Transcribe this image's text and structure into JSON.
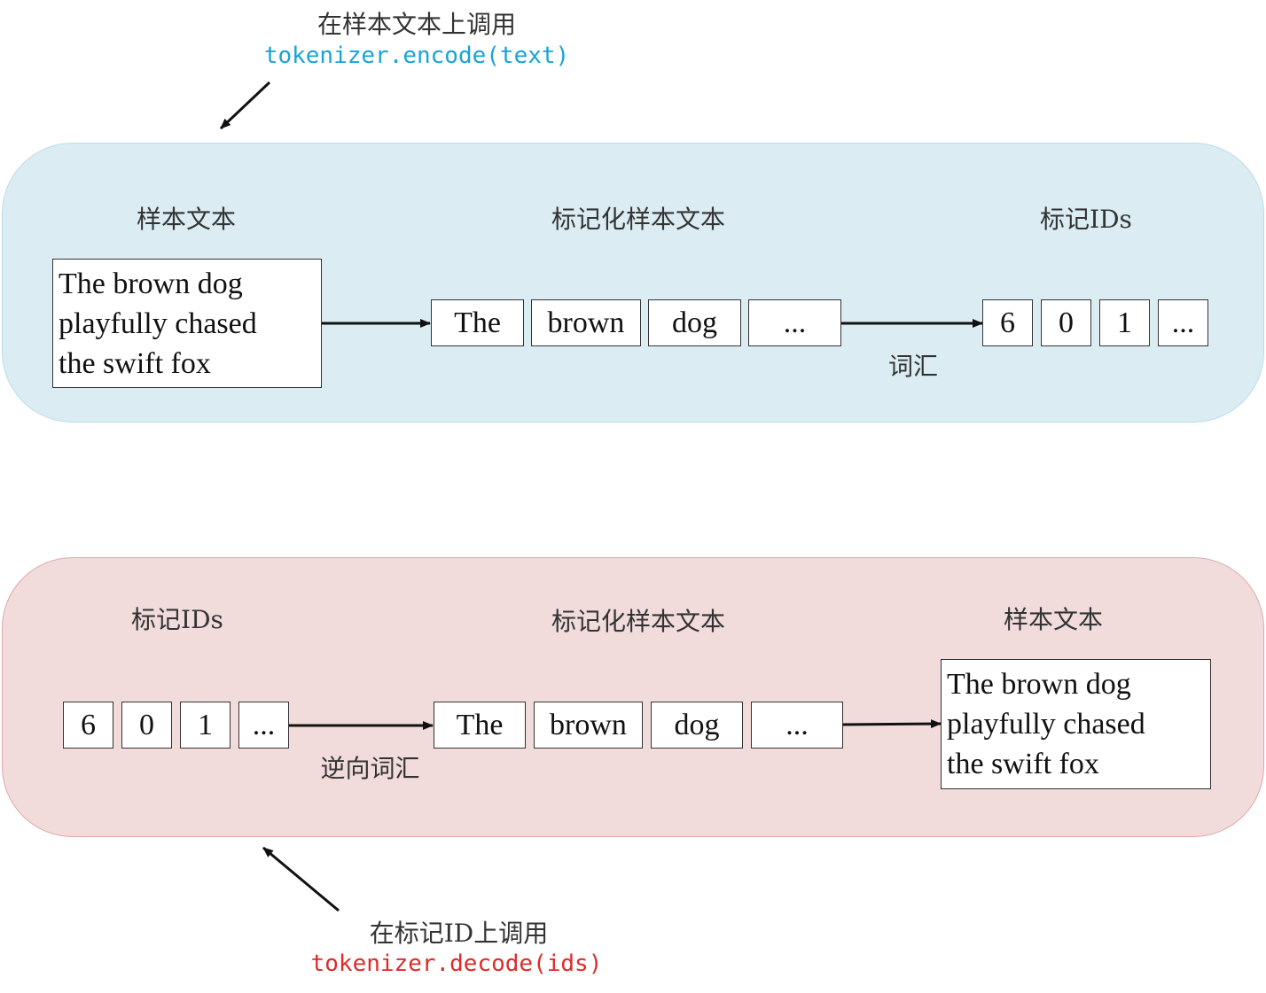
{
  "encode": {
    "callout": {
      "caption": "在样本文本上调用",
      "code": "tokenizer.encode(text)"
    },
    "sample_text_label": "样本文本",
    "tokenized_label": "标记化样本文本",
    "token_ids_label": "标记IDs",
    "sample_text_lines": [
      "The brown dog",
      "playfully chased",
      "the swift fox"
    ],
    "tokens": [
      "The",
      "brown",
      "dog",
      "..."
    ],
    "ids": [
      "6",
      "0",
      "1",
      "..."
    ],
    "arrow_label": "词汇"
  },
  "decode": {
    "token_ids_label": "标记IDs",
    "tokenized_label": "标记化样本文本",
    "sample_text_label": "样本文本",
    "ids": [
      "6",
      "0",
      "1",
      "..."
    ],
    "tokens": [
      "The",
      "brown",
      "dog",
      "..."
    ],
    "sample_text_lines": [
      "The brown dog",
      "playfully chased",
      "the swift fox"
    ],
    "arrow_label": "逆向词汇",
    "callout": {
      "caption": "在标记ID上调用",
      "code": "tokenizer.decode(ids)"
    }
  },
  "colors": {
    "encode_panel": "#dbedf3",
    "decode_panel": "#f1dbdb",
    "encode_code": "#1aa3d6",
    "decode_code": "#e02a2a"
  }
}
